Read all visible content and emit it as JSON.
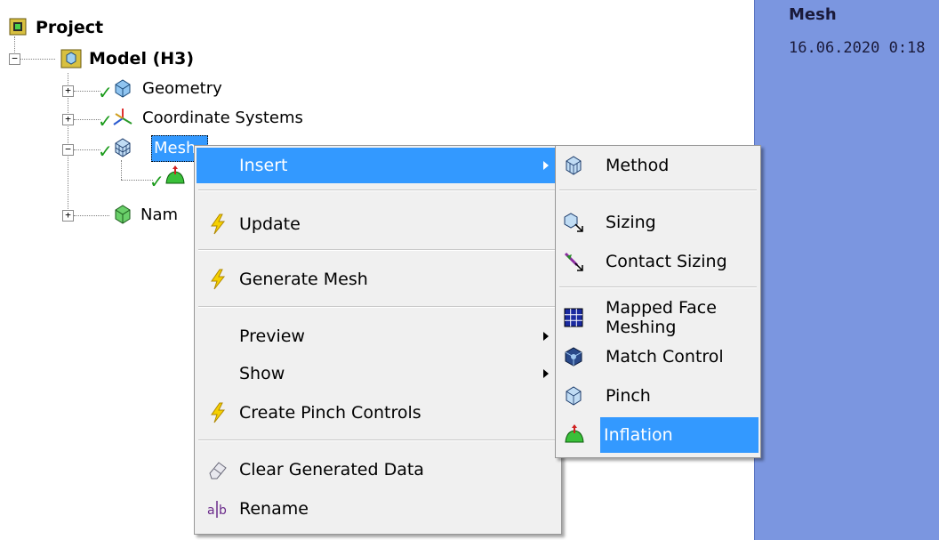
{
  "tree": {
    "project_label": "Project",
    "model_label": "Model (H3)",
    "geometry_label": "Geometry",
    "coord_label": "Coordinate Systems",
    "mesh_label": "Mesh",
    "named_label": "Nam"
  },
  "details_panel": {
    "title": "Mesh",
    "date": "16.06.2020 0:18"
  },
  "context_menu": {
    "insert": "Insert",
    "update": "Update",
    "generate_mesh": "Generate Mesh",
    "preview": "Preview",
    "show": "Show",
    "create_pinch": "Create Pinch Controls",
    "clear_generated": "Clear Generated Data",
    "rename": "Rename"
  },
  "insert_submenu": {
    "method": "Method",
    "sizing": "Sizing",
    "contact_sizing": "Contact Sizing",
    "mapped_face": "Mapped Face Meshing",
    "match_control": "Match Control",
    "pinch": "Pinch",
    "inflation": "Inflation"
  },
  "colors": {
    "highlight": "#3399ff",
    "menu_bg": "#f0f0f0",
    "panel_bg": "#7b96e0",
    "check_green": "#1a9a1a"
  }
}
